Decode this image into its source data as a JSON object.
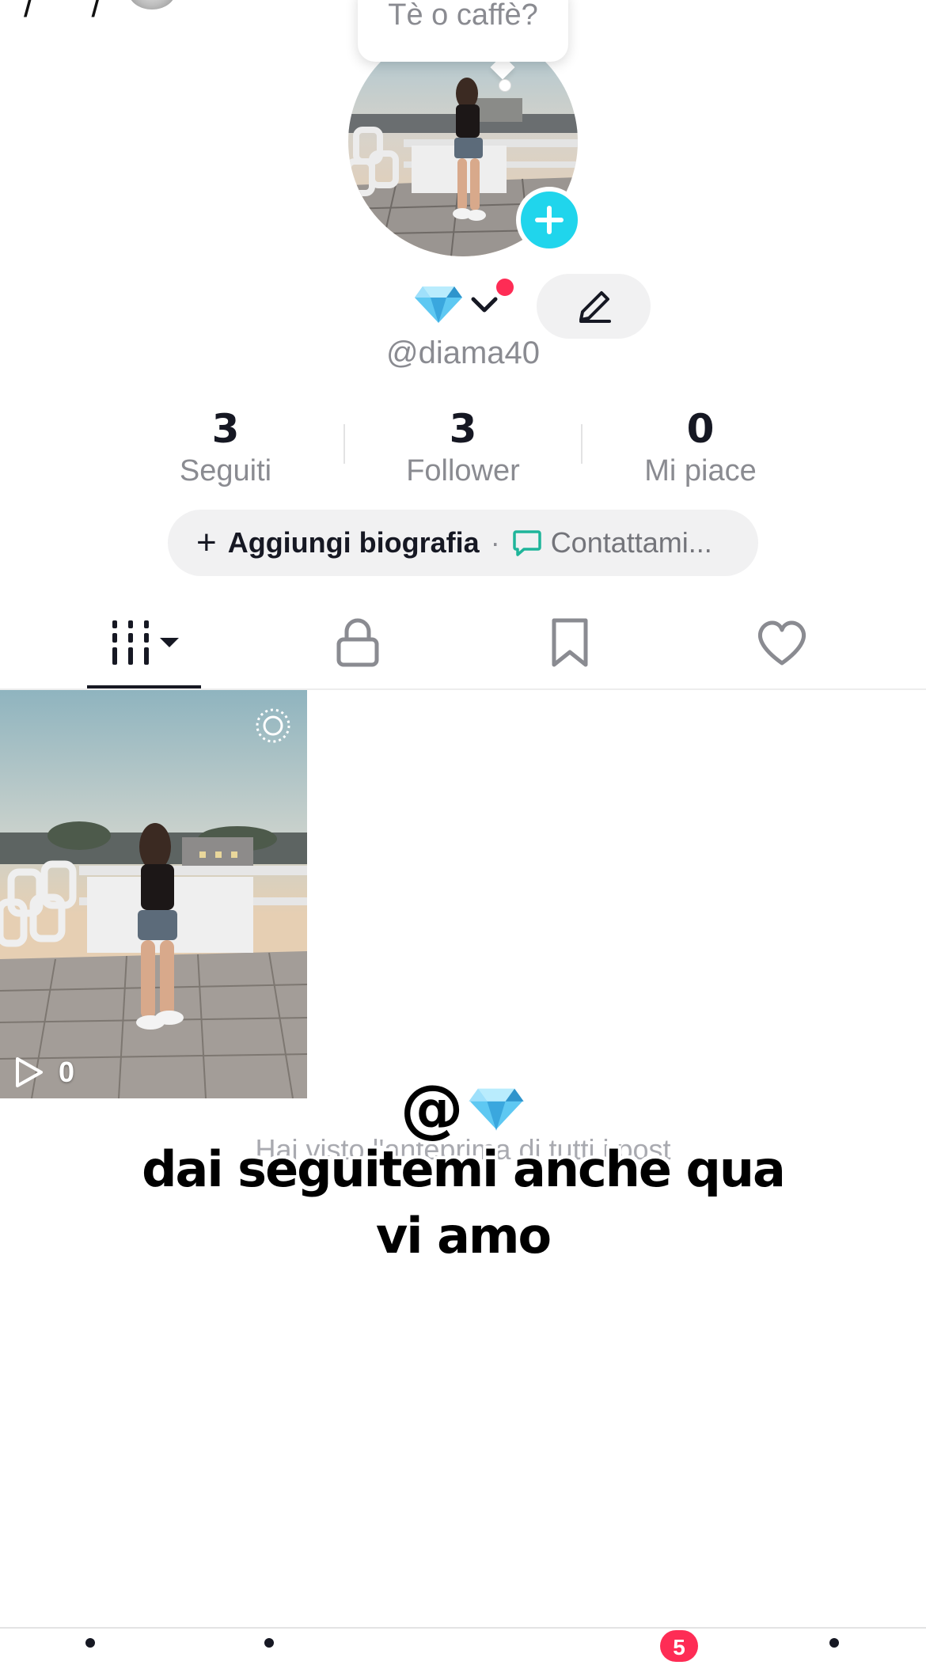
{
  "top_bar": {
    "left_glyphs": "/ /"
  },
  "bubble": {
    "text": "Tè o caffè?"
  },
  "profile": {
    "name_emoji": "💎",
    "username": "@diama40"
  },
  "stats": [
    {
      "value": "3",
      "label": "Seguiti"
    },
    {
      "value": "3",
      "label": "Follower"
    },
    {
      "value": "0",
      "label": "Mi piace"
    }
  ],
  "bio": {
    "add_label": "Aggiungi biografia",
    "separator": "·",
    "contact_label": "Contattami..."
  },
  "tabs": [
    {
      "icon": "videos-grid-icon",
      "selected": true
    },
    {
      "icon": "lock-icon",
      "selected": false
    },
    {
      "icon": "bookmark-icon",
      "selected": false
    },
    {
      "icon": "heart-icon",
      "selected": false
    }
  ],
  "posts": [
    {
      "play_count": "0"
    }
  ],
  "hint": "Hai visto l'anteprima di tutti i post",
  "overlay": {
    "tag_at": "@",
    "tag_emoji": "💎",
    "caption": "dai seguitemi anche qua vi amo"
  },
  "bottom_nav": {
    "inbox_badge": "5"
  },
  "colors": {
    "accent_cyan": "#20d5ec",
    "accent_red": "#fe2c55",
    "text_primary": "#161823",
    "text_secondary": "#8a8b91",
    "pill_bg": "#f1f1f2"
  }
}
